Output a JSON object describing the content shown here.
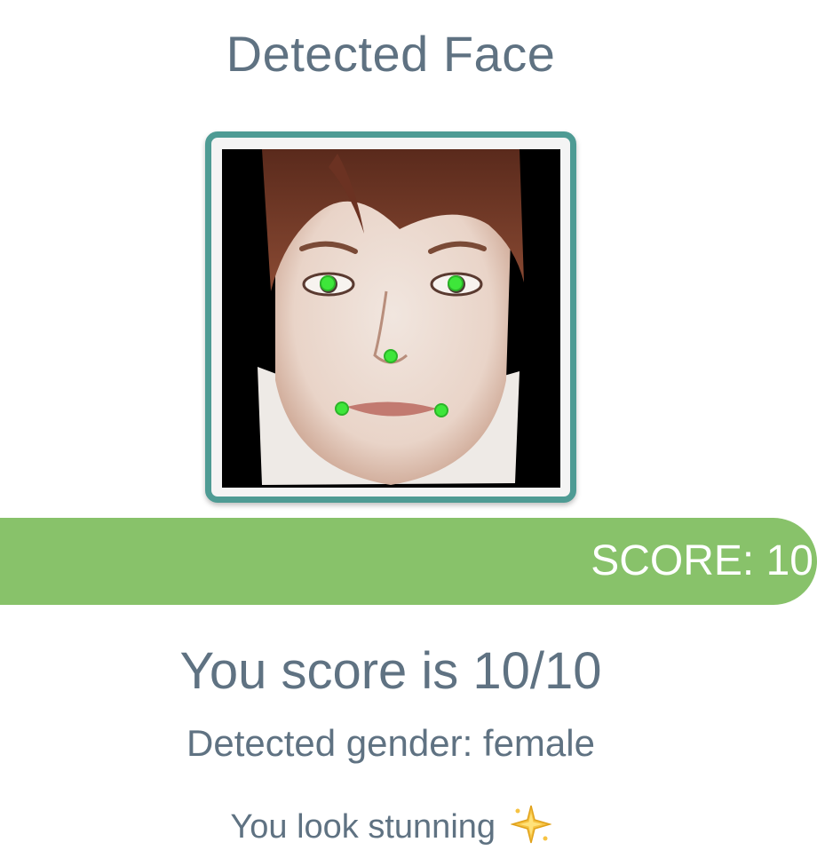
{
  "header": {
    "title": "Detected Face"
  },
  "face": {
    "landmark_color": "#3ee63a",
    "frame_color": "#4e9b94"
  },
  "score_bar": {
    "label": "SCORE: 10",
    "color": "#88c26a"
  },
  "result": {
    "score_text": "You score is 10/10",
    "gender_text": "Detected gender: female",
    "message_text": "You look stunning",
    "message_icon": "sparkle-icon"
  }
}
